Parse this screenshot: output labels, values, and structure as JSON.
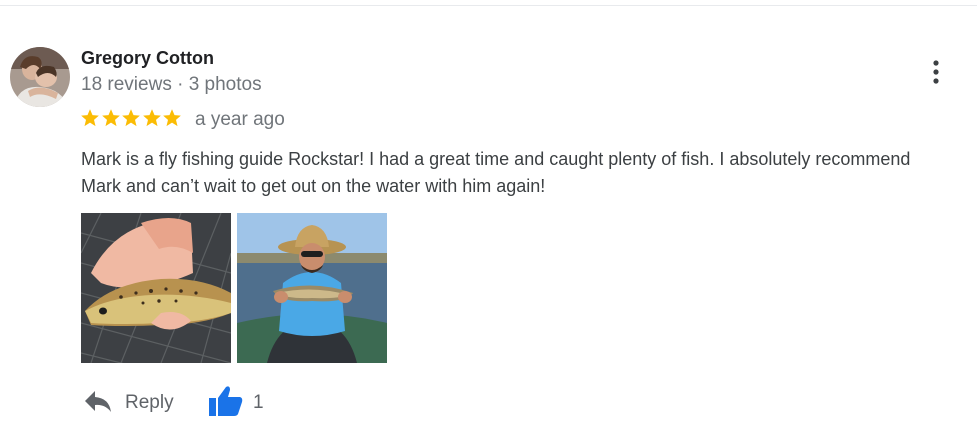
{
  "review": {
    "reviewer": {
      "name": "Gregory Cotton",
      "meta": "18 reviews · 3 photos"
    },
    "rating": 5,
    "date": "a year ago",
    "text_lines": [
      "Mark is a fly fishing guide Rockstar! I had a great time and caught plenty of fish. I absolutely recommend",
      "Mark and can’t wait to get out on the water with him again!"
    ],
    "actions": {
      "reply_label": "Reply",
      "like_count": "1"
    }
  },
  "colors": {
    "star": "#fbbc04",
    "like_icon": "#1a73e8",
    "name_text": "#202124",
    "meta_text": "#70757a",
    "body_text": "#3c4043"
  },
  "icons": [
    "more-vert-icon",
    "star-icon",
    "reply-icon",
    "thumbs-up-icon"
  ]
}
